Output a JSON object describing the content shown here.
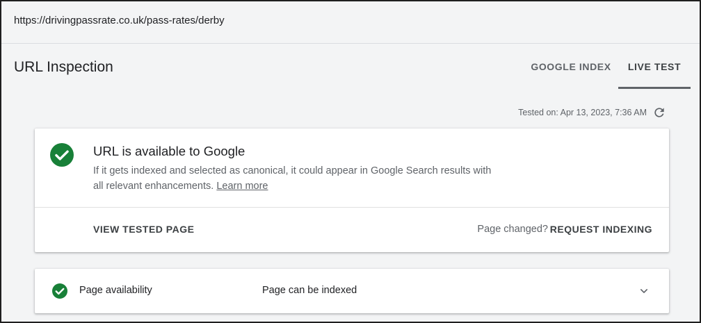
{
  "url_bar": {
    "url": "https://drivingpassrate.co.uk/pass-rates/derby"
  },
  "header": {
    "title": "URL Inspection",
    "tabs": [
      {
        "label": "GOOGLE INDEX",
        "active": false
      },
      {
        "label": "LIVE TEST",
        "active": true
      }
    ]
  },
  "test_info": {
    "tested_on": "Tested on: Apr 13, 2023, 7:36 AM",
    "refresh_icon": "refresh-icon"
  },
  "status_card": {
    "icon": "check-circle-icon",
    "title": "URL is available to Google",
    "description": "If it gets indexed and selected as canonical, it could appear in Google Search results with all relevant enhancements.",
    "learn_more": "Learn more",
    "view_tested_page": "VIEW TESTED PAGE",
    "page_changed": "Page changed?",
    "request_indexing": "REQUEST INDEXING"
  },
  "availability": {
    "icon": "check-circle-icon",
    "label": "Page availability",
    "value": "Page can be indexed",
    "expand_icon": "chevron-down-icon"
  },
  "colors": {
    "success_green": "#188038",
    "background": "#f3f4f5",
    "tab_indicator": "#5f6368"
  }
}
